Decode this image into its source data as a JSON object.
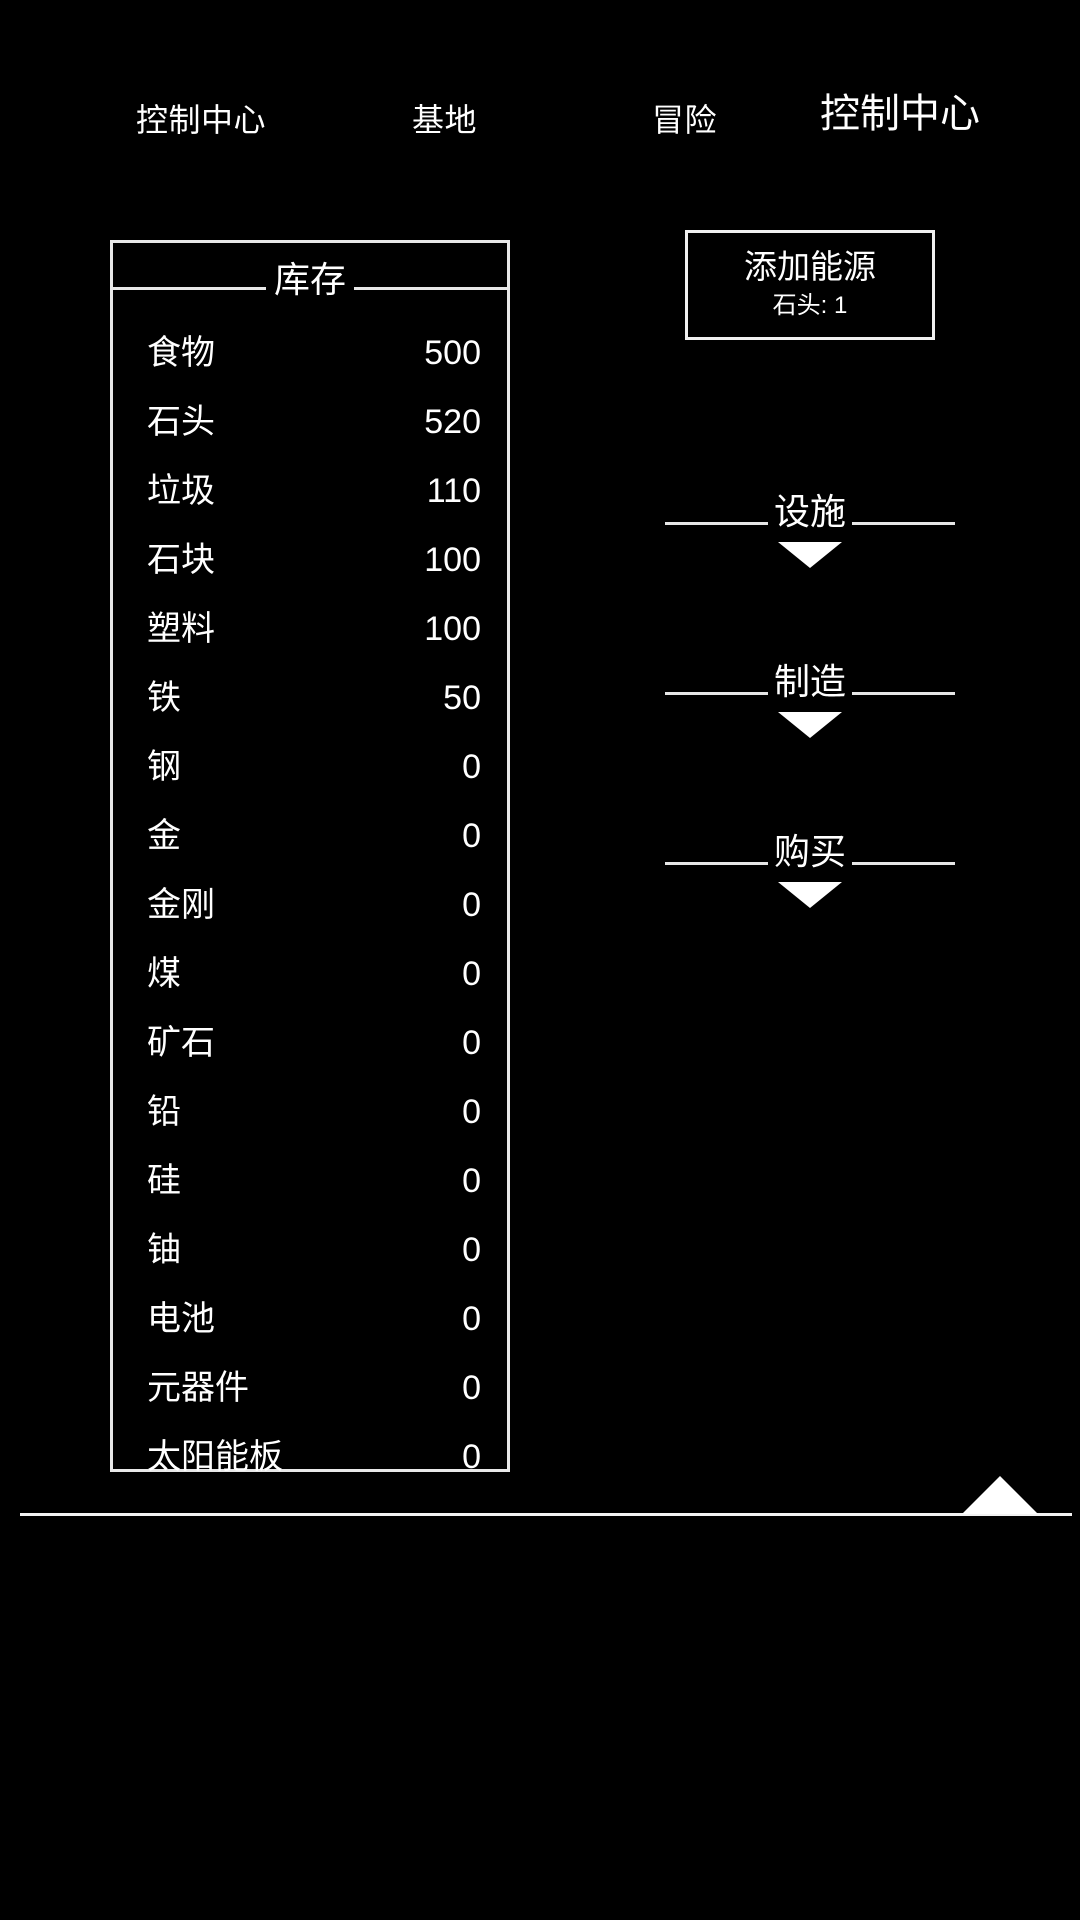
{
  "nav": {
    "items": [
      {
        "label": "控制中心"
      },
      {
        "label": "基地"
      },
      {
        "label": "冒险"
      }
    ],
    "page_title": "控制中心"
  },
  "inventory": {
    "title": "库存",
    "rows": [
      {
        "name": "食物",
        "value": "500"
      },
      {
        "name": "石头",
        "value": "520"
      },
      {
        "name": "垃圾",
        "value": "110"
      },
      {
        "name": "石块",
        "value": "100"
      },
      {
        "name": "塑料",
        "value": "100"
      },
      {
        "name": "铁",
        "value": "50"
      },
      {
        "name": "钢",
        "value": "0"
      },
      {
        "name": "金",
        "value": "0"
      },
      {
        "name": "金刚",
        "value": "0"
      },
      {
        "name": "煤",
        "value": "0"
      },
      {
        "name": "矿石",
        "value": "0"
      },
      {
        "name": "铅",
        "value": "0"
      },
      {
        "name": "硅",
        "value": "0"
      },
      {
        "name": "铀",
        "value": "0"
      },
      {
        "name": "电池",
        "value": "0"
      },
      {
        "name": "元器件",
        "value": "0"
      },
      {
        "name": "太阳能板",
        "value": "0"
      }
    ]
  },
  "actions": {
    "energy_button": {
      "label": "添加能源",
      "cost": "石头: 1"
    },
    "sections": [
      {
        "label": "设施",
        "chevron": "chevron-down-icon"
      },
      {
        "label": "制造",
        "chevron": "chevron-down-icon"
      },
      {
        "label": "购买",
        "chevron": "chevron-down-icon"
      }
    ]
  },
  "bottom": {
    "scroll_top_icon": "triangle-up-icon"
  },
  "colors": {
    "background": "#000000",
    "foreground": "#ffffff",
    "border": "#e8e8e8"
  }
}
